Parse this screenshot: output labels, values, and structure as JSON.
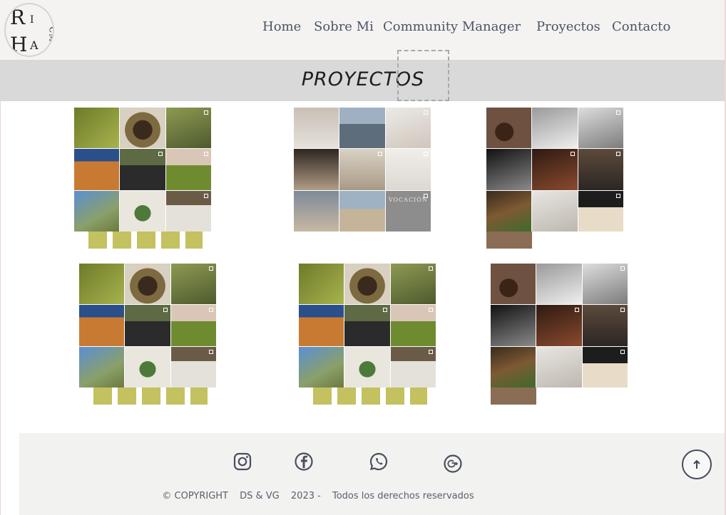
{
  "logo": {
    "letters": [
      "R",
      "I",
      "H",
      "A",
      "CM"
    ]
  },
  "nav": {
    "home": "Home",
    "sobre": "Sobre Mi",
    "community": "Community Manager",
    "proyectos": "Proyectos",
    "contacto": "Contacto"
  },
  "banner": {
    "title": "PROYECTOS"
  },
  "projects": [
    {
      "theme": "olive"
    },
    {
      "theme": "neutral",
      "caption": "VOCACIÓN"
    },
    {
      "theme": "food"
    },
    {
      "theme": "olive"
    },
    {
      "theme": "olive"
    },
    {
      "theme": "food"
    }
  ],
  "footer": {
    "social": [
      "instagram-icon",
      "facebook-icon",
      "whatsapp-icon",
      "google-plus-icon"
    ],
    "copyright": "© COPYRIGHT",
    "authors": "DS & VG",
    "year": "2023 -",
    "rights": "Todos los derechos reservados"
  },
  "colors": {
    "header_bg": "#f4f3f1",
    "banner_bg": "#d9d9d9",
    "footer_bg": "#f2f2f1",
    "nav_text": "#4a5366"
  }
}
